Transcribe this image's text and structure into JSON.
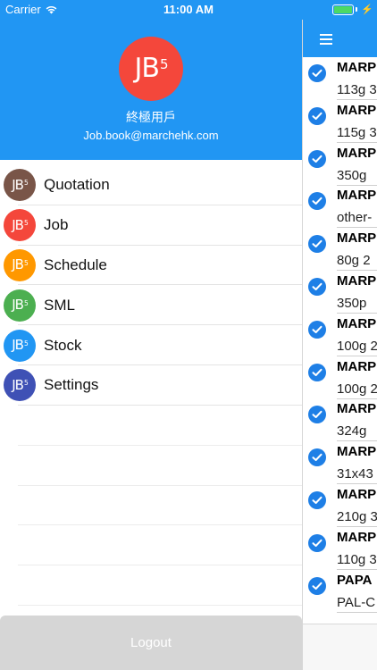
{
  "status_bar": {
    "carrier": "Carrier",
    "time": "11:00 AM"
  },
  "drawer": {
    "logo_text": "JB",
    "logo_sup": "5",
    "user_name": "終極用戶",
    "user_email": "Job.book@marchehk.com",
    "menu": [
      {
        "label": "Quotation",
        "color": "#795548"
      },
      {
        "label": "Job",
        "color": "#f4473b"
      },
      {
        "label": "Schedule",
        "color": "#ff9800"
      },
      {
        "label": "SML",
        "color": "#4caf50"
      },
      {
        "label": "Stock",
        "color": "#2196f3"
      },
      {
        "label": "Settings",
        "color": "#3f51b5"
      }
    ],
    "logout_label": "Logout"
  },
  "list": {
    "items": [
      {
        "title": "MARP",
        "subtitle": "113g 3"
      },
      {
        "title": "MARP",
        "subtitle": "115g 3"
      },
      {
        "title": "MARP",
        "subtitle": "350g"
      },
      {
        "title": "MARP",
        "subtitle": "other-"
      },
      {
        "title": "MARP",
        "subtitle": "80g 2"
      },
      {
        "title": "MARP",
        "subtitle": "350p"
      },
      {
        "title": "MARP",
        "subtitle": "100g 2"
      },
      {
        "title": "MARP",
        "subtitle": "100g 2"
      },
      {
        "title": "MARP",
        "subtitle": "324g"
      },
      {
        "title": "MARP",
        "subtitle": "31x43"
      },
      {
        "title": "MARP",
        "subtitle": "210g 3"
      },
      {
        "title": "MARP",
        "subtitle": "110g 3"
      },
      {
        "title": "PAPA",
        "subtitle": "PAL-C"
      }
    ]
  },
  "colors": {
    "primary": "#2196f3",
    "check": "#1e7fe6",
    "logout_bg": "#d6d6d6"
  },
  "icons": {
    "menu": "hamburger-icon",
    "checked": "check-circle-icon",
    "wifi": "wifi-icon",
    "battery": "battery-icon"
  }
}
